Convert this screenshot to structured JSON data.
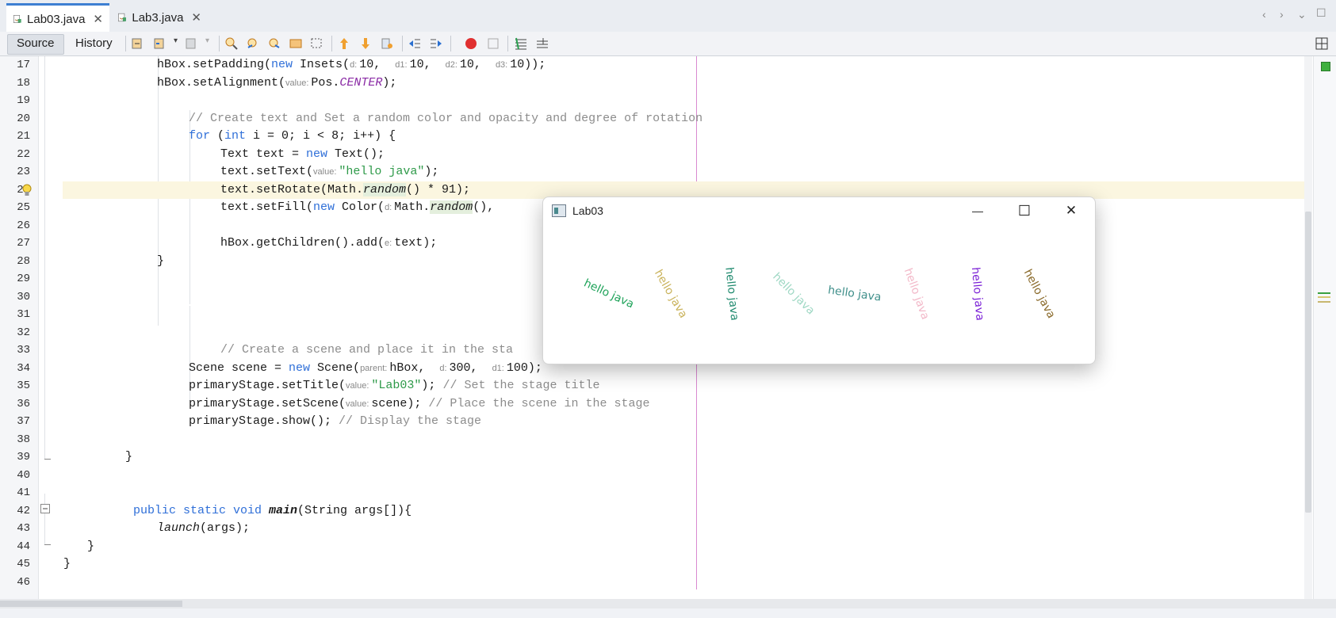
{
  "tabs": [
    {
      "label": "Lab03.java",
      "close": "✕",
      "active": true
    },
    {
      "label": "Lab3.java",
      "close": "✕",
      "active": false
    }
  ],
  "toolbar": {
    "source_label": "Source",
    "history_label": "History"
  },
  "editor": {
    "lines": [
      {
        "n": "17"
      },
      {
        "n": "18"
      },
      {
        "n": "19"
      },
      {
        "n": "20"
      },
      {
        "n": "21"
      },
      {
        "n": "22"
      },
      {
        "n": "23"
      },
      {
        "n": "24"
      },
      {
        "n": "25"
      },
      {
        "n": "26"
      },
      {
        "n": "27"
      },
      {
        "n": "28"
      },
      {
        "n": "29"
      },
      {
        "n": "30"
      },
      {
        "n": "31"
      },
      {
        "n": "32"
      },
      {
        "n": "33"
      },
      {
        "n": "34"
      },
      {
        "n": "35"
      },
      {
        "n": "36"
      },
      {
        "n": "37"
      },
      {
        "n": "38"
      },
      {
        "n": "39"
      },
      {
        "n": "40"
      },
      {
        "n": "41"
      },
      {
        "n": "42"
      },
      {
        "n": "43"
      },
      {
        "n": "44"
      },
      {
        "n": "45"
      },
      {
        "n": "46"
      }
    ]
  },
  "code": {
    "l17": {
      "a": "hBox.setPadding(",
      "kw": "new",
      "b": " Insets(",
      "h1": "d:",
      "v1": "10, ",
      "h2": "d1:",
      "v2": "10, ",
      "h3": "d2:",
      "v3": "10, ",
      "h4": "d3:",
      "v4": "10));"
    },
    "l18": {
      "a": "hBox.setAlignment(",
      "h1": "value:",
      "b": "Pos.",
      "c": "CENTER",
      "d": ");"
    },
    "l20": {
      "cm": "// Create text and Set a random color and opacity and degree of rotation"
    },
    "l21": {
      "kw1": "for",
      "a": " (",
      "kw2": "int",
      "b": " i = 0; i < 8; i++) {"
    },
    "l22": {
      "a": "Text text = ",
      "kw": "new",
      "b": " Text();"
    },
    "l23": {
      "a": "text.setText(",
      "h1": "value:",
      "s": "\"hello java\"",
      "b": ");"
    },
    "l24": {
      "a": "text.setRotate(Math.",
      "m": "random",
      "b": "() * 91);"
    },
    "l25": {
      "a": "text.setFill(",
      "kw": "new",
      "b": " Color(",
      "h1": "d:",
      "c": "Math.",
      "m": "random",
      "d": "(),"
    },
    "l27": {
      "a": "hBox.getChildren().add(",
      "h1": "e:",
      "b": "text);"
    },
    "l28": {
      "a": "}"
    },
    "l33": {
      "cm": "// Create a scene and place it in the sta"
    },
    "l34": {
      "a": "Scene scene = ",
      "kw": "new",
      "b": " Scene(",
      "h1": "parent:",
      "v1": "hBox, ",
      "h2": "d:",
      "v2": "300, ",
      "h3": "d1:",
      "v3": "100);"
    },
    "l35": {
      "a": "primaryStage.setTitle(",
      "h1": "value:",
      "s": "\"Lab03\"",
      "b": "); ",
      "cm": "// Set the stage title"
    },
    "l36": {
      "a": "primaryStage.setScene(",
      "h1": "value:",
      "b": "scene); ",
      "cm": "// Place the scene in the stage"
    },
    "l37": {
      "a": "primaryStage.show(); ",
      "cm": "// Display the stage"
    },
    "l39": {
      "a": "}"
    },
    "l42": {
      "kw": "public static void ",
      "m": "main",
      "b": "(String args[]){"
    },
    "l43": {
      "m": "launch",
      "b": "(args);"
    },
    "l44": {
      "a": "}"
    },
    "l45": {
      "a": "}"
    }
  },
  "window": {
    "title": "Lab03",
    "minimize": "—",
    "maximize": "☐",
    "close": "✕",
    "texts": [
      {
        "text": "hello java",
        "color": "#1fa35a",
        "rotation": 25
      },
      {
        "text": "hello java",
        "color": "#c9b25a",
        "rotation": 60
      },
      {
        "text": "hello java",
        "color": "#1f8a6e",
        "rotation": 84
      },
      {
        "text": "hello java",
        "color": "#9fd8c4",
        "rotation": 45
      },
      {
        "text": "hello java",
        "color": "#3f8f8a",
        "rotation": 8
      },
      {
        "text": "hello java",
        "color": "#f2b8c8",
        "rotation": 70
      },
      {
        "text": "hello java",
        "color": "#7a1fd6",
        "rotation": 85
      },
      {
        "text": "hello java",
        "color": "#8a6a2a",
        "rotation": 62
      }
    ]
  }
}
